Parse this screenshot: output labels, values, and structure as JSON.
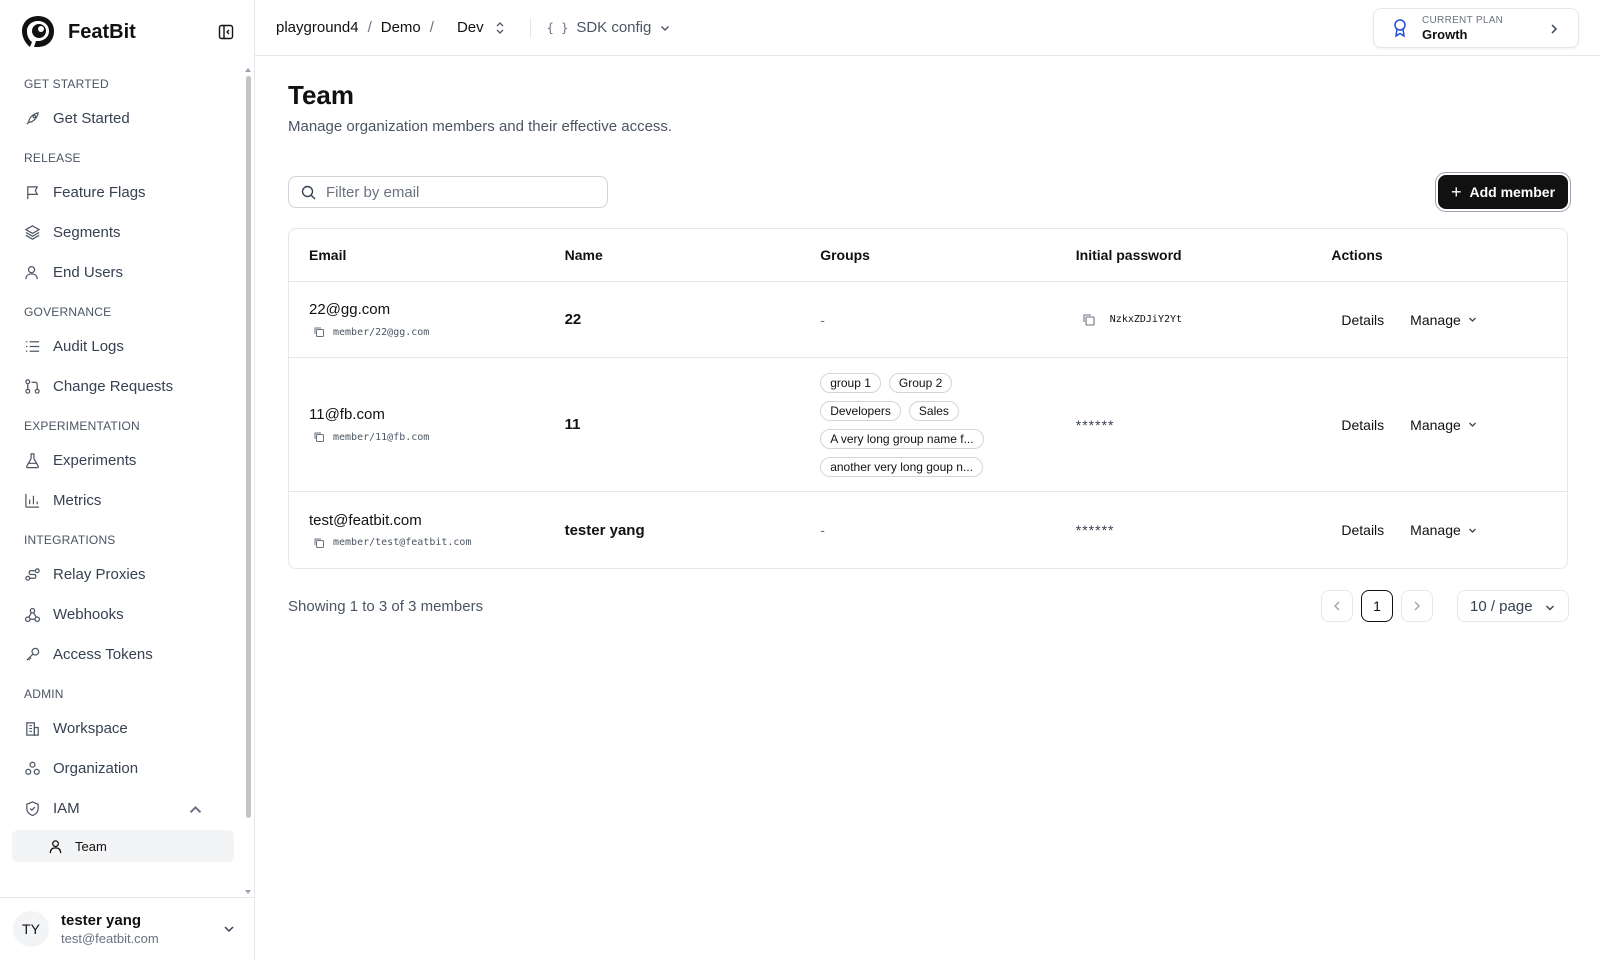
{
  "brand": {
    "name": "FeatBit"
  },
  "sidebar": {
    "sections": {
      "get_started": "GET STARTED",
      "release": "RELEASE",
      "governance": "GOVERNANCE",
      "experimentation": "EXPERIMENTATION",
      "integrations": "INTEGRATIONS",
      "admin": "ADMIN"
    },
    "items": {
      "get_started": "Get Started",
      "feature_flags": "Feature Flags",
      "segments": "Segments",
      "end_users": "End Users",
      "audit_logs": "Audit Logs",
      "change_requests": "Change Requests",
      "experiments": "Experiments",
      "metrics": "Metrics",
      "relay_proxies": "Relay Proxies",
      "webhooks": "Webhooks",
      "access_tokens": "Access Tokens",
      "workspace": "Workspace",
      "organization": "Organization",
      "iam": "IAM",
      "team": "Team"
    },
    "user": {
      "initials": "TY",
      "name": "tester yang",
      "email": "test@featbit.com"
    }
  },
  "topbar": {
    "breadcrumb": [
      "playground4",
      "Demo",
      "Dev"
    ],
    "sdk": {
      "icon": "{ }",
      "label": "SDK config"
    },
    "plan": {
      "kicker": "CURRENT PLAN",
      "name": "Growth"
    }
  },
  "page": {
    "title": "Team",
    "subtitle": "Manage organization members and their effective access.",
    "search_placeholder": "Filter by email",
    "add_button": "Add member",
    "columns": {
      "email": "Email",
      "name": "Name",
      "groups": "Groups",
      "password": "Initial password",
      "actions": "Actions"
    },
    "rows": [
      {
        "email": "22@gg.com",
        "key": "member/22@gg.com",
        "name": "22",
        "groups_empty": "-",
        "password": "NzkxZDJiY2Yt",
        "details": "Details",
        "manage": "Manage"
      },
      {
        "email": "11@fb.com",
        "key": "member/11@fb.com",
        "name": "11",
        "groups": [
          "group 1",
          "Group 2",
          "Developers",
          "Sales",
          "A very long group name f...",
          "another very long goup n..."
        ],
        "password": "******",
        "details": "Details",
        "manage": "Manage"
      },
      {
        "email": "test@featbit.com",
        "key": "member/test@featbit.com",
        "name": "tester yang",
        "groups_empty": "-",
        "password": "******",
        "details": "Details",
        "manage": "Manage"
      }
    ],
    "footer": {
      "count": "Showing 1 to 3 of 3 members",
      "page": "1",
      "page_size": "10 / page"
    }
  },
  "colors": {
    "primary": "#111111",
    "border": "#e5e7eb",
    "muted": "#6b7280"
  }
}
